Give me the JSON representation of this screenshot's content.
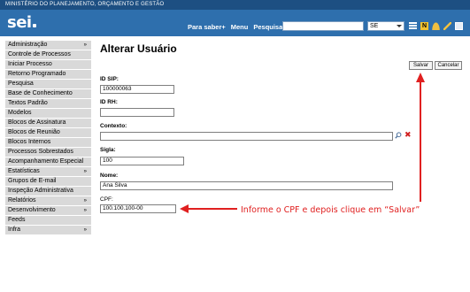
{
  "header": {
    "ministry": "MINISTÉRIO DO PLANEJAMENTO, ORÇAMENTO E GESTÃO",
    "logo": "sei",
    "links": [
      "Para saber+",
      "Menu",
      "Pesquisa"
    ],
    "search_value": "",
    "unit_select": "SE",
    "icons": [
      "units-grid-icon",
      "notification-n-icon",
      "user-icon",
      "pen-icon",
      "exit-icon"
    ]
  },
  "sidebar": {
    "items": [
      {
        "label": "Administração",
        "has_submenu": true
      },
      {
        "label": "Controle de Processos",
        "has_submenu": false
      },
      {
        "label": "Iniciar Processo",
        "has_submenu": false
      },
      {
        "label": "Retorno Programado",
        "has_submenu": false
      },
      {
        "label": "Pesquisa",
        "has_submenu": false
      },
      {
        "label": "Base de Conhecimento",
        "has_submenu": false
      },
      {
        "label": "Textos Padrão",
        "has_submenu": false
      },
      {
        "label": "Modelos",
        "has_submenu": false
      },
      {
        "label": "Blocos de Assinatura",
        "has_submenu": false
      },
      {
        "label": "Blocos de Reunião",
        "has_submenu": false
      },
      {
        "label": "Blocos Internos",
        "has_submenu": false
      },
      {
        "label": "Processos Sobrestados",
        "has_submenu": false
      },
      {
        "label": "Acompanhamento Especial",
        "has_submenu": false
      },
      {
        "label": "Estatísticas",
        "has_submenu": true
      },
      {
        "label": "Grupos de E-mail",
        "has_submenu": false
      },
      {
        "label": "Inspeção Administrativa",
        "has_submenu": false
      },
      {
        "label": "Relatórios",
        "has_submenu": true
      },
      {
        "label": "Desenvolvimento",
        "has_submenu": true
      },
      {
        "label": "Feeds",
        "has_submenu": false
      },
      {
        "label": "Infra",
        "has_submenu": true
      }
    ],
    "submenu_chevron": "»"
  },
  "page": {
    "title": "Alterar Usuário",
    "save_button": "Salvar",
    "cancel_button": "Cancelar"
  },
  "form": {
    "id_sip_label": "ID SIP:",
    "id_sip_value": "100000063",
    "id_rh_label": "ID RH:",
    "id_rh_value": "",
    "contexto_label": "Contexto:",
    "contexto_value": "",
    "sigla_label": "Sigla:",
    "sigla_value": "100",
    "nome_label": "Nome:",
    "nome_value": "Ana Silva",
    "cpf_label": "CPF:",
    "cpf_value": "100.100.100-00"
  },
  "annotation": {
    "text": "Informe o CPF e depois clique em “Salvar”",
    "color": "#e02020"
  }
}
